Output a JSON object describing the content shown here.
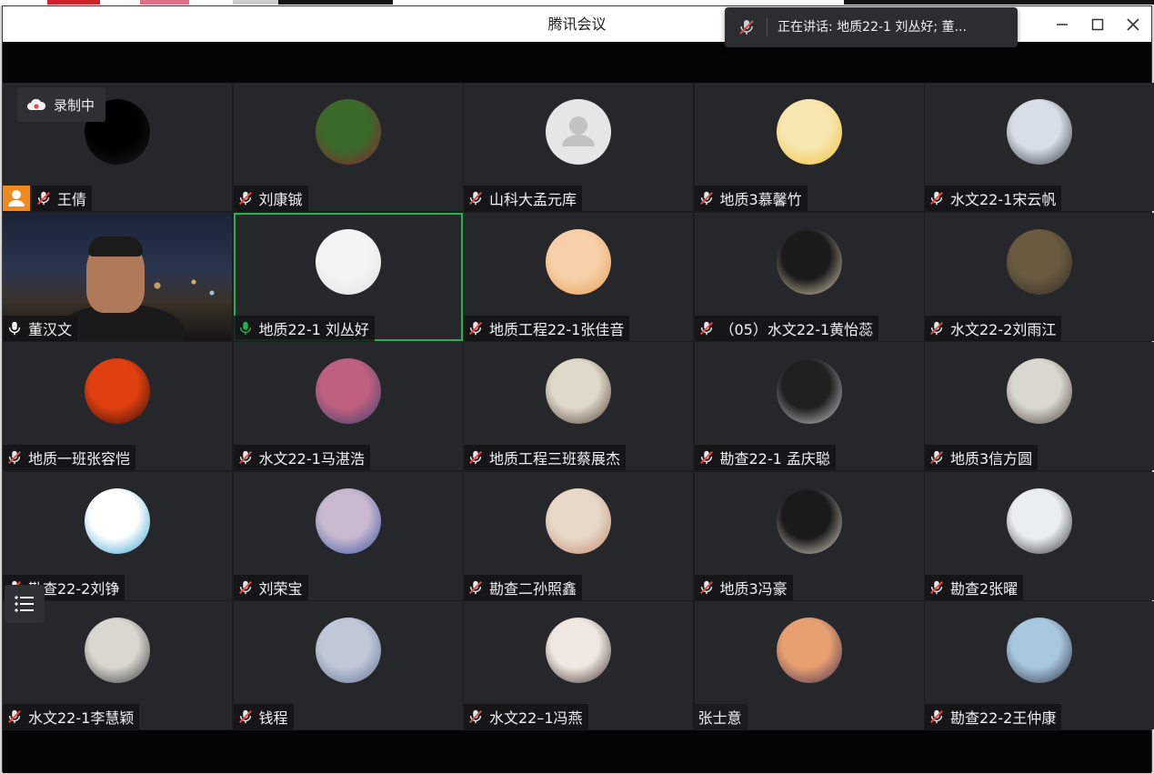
{
  "window": {
    "title": "腾讯会议",
    "controls": {
      "minimize_icon": "minimize-icon",
      "maximize_icon": "maximize-icon",
      "close_icon": "close-icon"
    }
  },
  "speaking_banner": {
    "text": "正在讲话: 地质22-1 刘丛好; 董..."
  },
  "recording_badge": {
    "label": "录制中"
  },
  "colors": {
    "active_border": "#23b24b",
    "host_badge": "#f08a1c",
    "mic_muted": "#e04a4a",
    "mic_active": "#23b24b",
    "tile_bg": "#26272b"
  },
  "participants": [
    {
      "name": "王倩",
      "mic": "muted",
      "host": true,
      "avatar": [
        "#000000",
        "#1a1a1a"
      ]
    },
    {
      "name": "刘康铖",
      "mic": "muted",
      "avatar": [
        "#3a6a2a",
        "#8a2030"
      ]
    },
    {
      "name": "山科大孟元库",
      "mic": "muted",
      "avatar": [
        "#e6e6e6",
        "#e6e6e6"
      ],
      "default_avatar": true
    },
    {
      "name": "地质3慕馨竹",
      "mic": "muted",
      "avatar": [
        "#f6e6b0",
        "#f0c030"
      ]
    },
    {
      "name": "水文22-1宋云帆",
      "mic": "muted",
      "avatar": [
        "#d8dee8",
        "#2a2f3a"
      ]
    },
    {
      "name": "董汉文",
      "mic": "on_white",
      "video": true
    },
    {
      "name": "地质22-1 刘丛好",
      "mic": "speaking",
      "active": true,
      "avatar": [
        "#f4f4f4",
        "#e0e0e0"
      ]
    },
    {
      "name": "地质工程22-1张佳音",
      "mic": "muted",
      "avatar": [
        "#f6d0a8",
        "#e89a50"
      ]
    },
    {
      "name": "（05）水文22-1黄怡蕊",
      "mic": "muted",
      "avatar": [
        "#1a1a1a",
        "#e6d6b8"
      ]
    },
    {
      "name": "水文22-2刘雨江",
      "mic": "muted",
      "avatar": [
        "#6a5a40",
        "#2c2a28"
      ]
    },
    {
      "name": "地质一班张容恺",
      "mic": "muted",
      "avatar": [
        "#e04010",
        "#2a0a0a"
      ]
    },
    {
      "name": "水文22-1马湛浩",
      "mic": "muted",
      "avatar": [
        "#c06080",
        "#304070"
      ]
    },
    {
      "name": "地质工程三班蔡展杰",
      "mic": "muted",
      "avatar": [
        "#e0d8c8",
        "#4a3a30"
      ]
    },
    {
      "name": "勘查22-1 孟庆聪",
      "mic": "muted",
      "avatar": [
        "#202020",
        "#d8d8d8"
      ]
    },
    {
      "name": "地质3信方圆",
      "mic": "muted",
      "avatar": [
        "#d8d8d0",
        "#4a3a34"
      ]
    },
    {
      "name": "勘查22-2刘铮",
      "mic": "muted",
      "avatar": [
        "#ffffff",
        "#2a9ad0"
      ]
    },
    {
      "name": "刘荣宝",
      "mic": "muted",
      "avatar": [
        "#c8b8d0",
        "#3050a0"
      ]
    },
    {
      "name": "勘查二孙照鑫",
      "mic": "muted",
      "avatar": [
        "#e8d8c8",
        "#c08870"
      ]
    },
    {
      "name": "地质3冯豪",
      "mic": "muted",
      "avatar": [
        "#1a1a1a",
        "#e8e0d0"
      ]
    },
    {
      "name": "勘查2张曜",
      "mic": "muted",
      "avatar": [
        "#e8eef2",
        "#2a2a2a"
      ]
    },
    {
      "name": "水文22-1李慧颖",
      "mic": "muted",
      "avatar": [
        "#d8d8d0",
        "#303030"
      ]
    },
    {
      "name": "钱程",
      "mic": "muted",
      "avatar": [
        "#c0c8d8",
        "#607090"
      ]
    },
    {
      "name": "水文22–1冯燕",
      "mic": "muted",
      "avatar": [
        "#f0e8e0",
        "#3a2a2a"
      ]
    },
    {
      "name": "张士意",
      "mic": "none",
      "avatar": [
        "#e8a070",
        "#3a2a50"
      ]
    },
    {
      "name": "勘查22-2王仲康",
      "mic": "muted",
      "avatar": [
        "#a8c8e0",
        "#2a2a3a"
      ]
    }
  ]
}
